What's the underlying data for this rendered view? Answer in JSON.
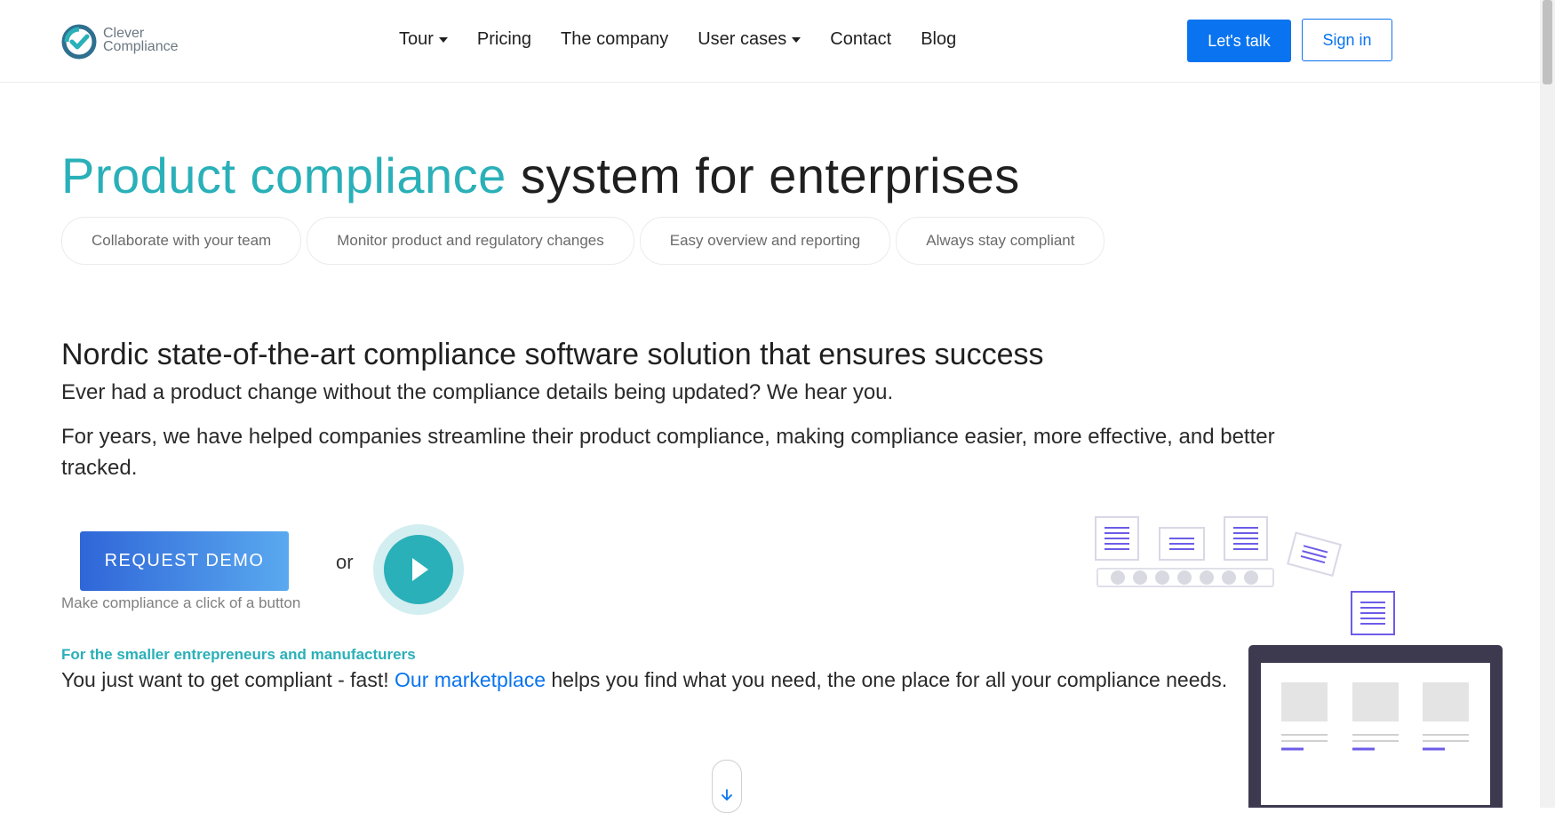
{
  "header": {
    "logo": {
      "line1": "Clever",
      "line2": "Compliance"
    },
    "nav": [
      {
        "label": "Tour",
        "dropdown": true
      },
      {
        "label": "Pricing",
        "dropdown": false
      },
      {
        "label": "The company",
        "dropdown": false
      },
      {
        "label": "User cases",
        "dropdown": true
      },
      {
        "label": "Contact",
        "dropdown": false
      },
      {
        "label": "Blog",
        "dropdown": false
      }
    ],
    "talk_label": "Let's talk",
    "signin_label": "Sign in"
  },
  "hero": {
    "title_accent": "Product compliance",
    "title_rest": " system for enterprises",
    "pills": [
      "Collaborate with your team",
      "Monitor product and regulatory changes",
      "Easy overview and reporting",
      "Always stay compliant"
    ]
  },
  "intro": {
    "subhead": "Nordic state-of-the-art compliance software solution that ensures success",
    "para1": "Ever had a product change without the compliance details being updated? We hear you.",
    "para2": "For years, we have helped companies streamline their product compliance, making compliance easier, more effective, and better tracked."
  },
  "cta": {
    "demo_label": "REQUEST DEMO",
    "demo_caption": "Make compliance a click of a button",
    "or_label": "or"
  },
  "smaller": {
    "heading": "For the smaller entrepreneurs and manufacturers",
    "text_before": "You just want to get compliant - fast! ",
    "link_label": "Our marketplace",
    "text_after": " helps you find what you need, the one place for all your compliance needs."
  },
  "colors": {
    "accent": "#2ab0b8",
    "primary": "#0a74f0",
    "illustration_purple": "#6c5ce7",
    "illustration_dark": "#3d3a50"
  }
}
